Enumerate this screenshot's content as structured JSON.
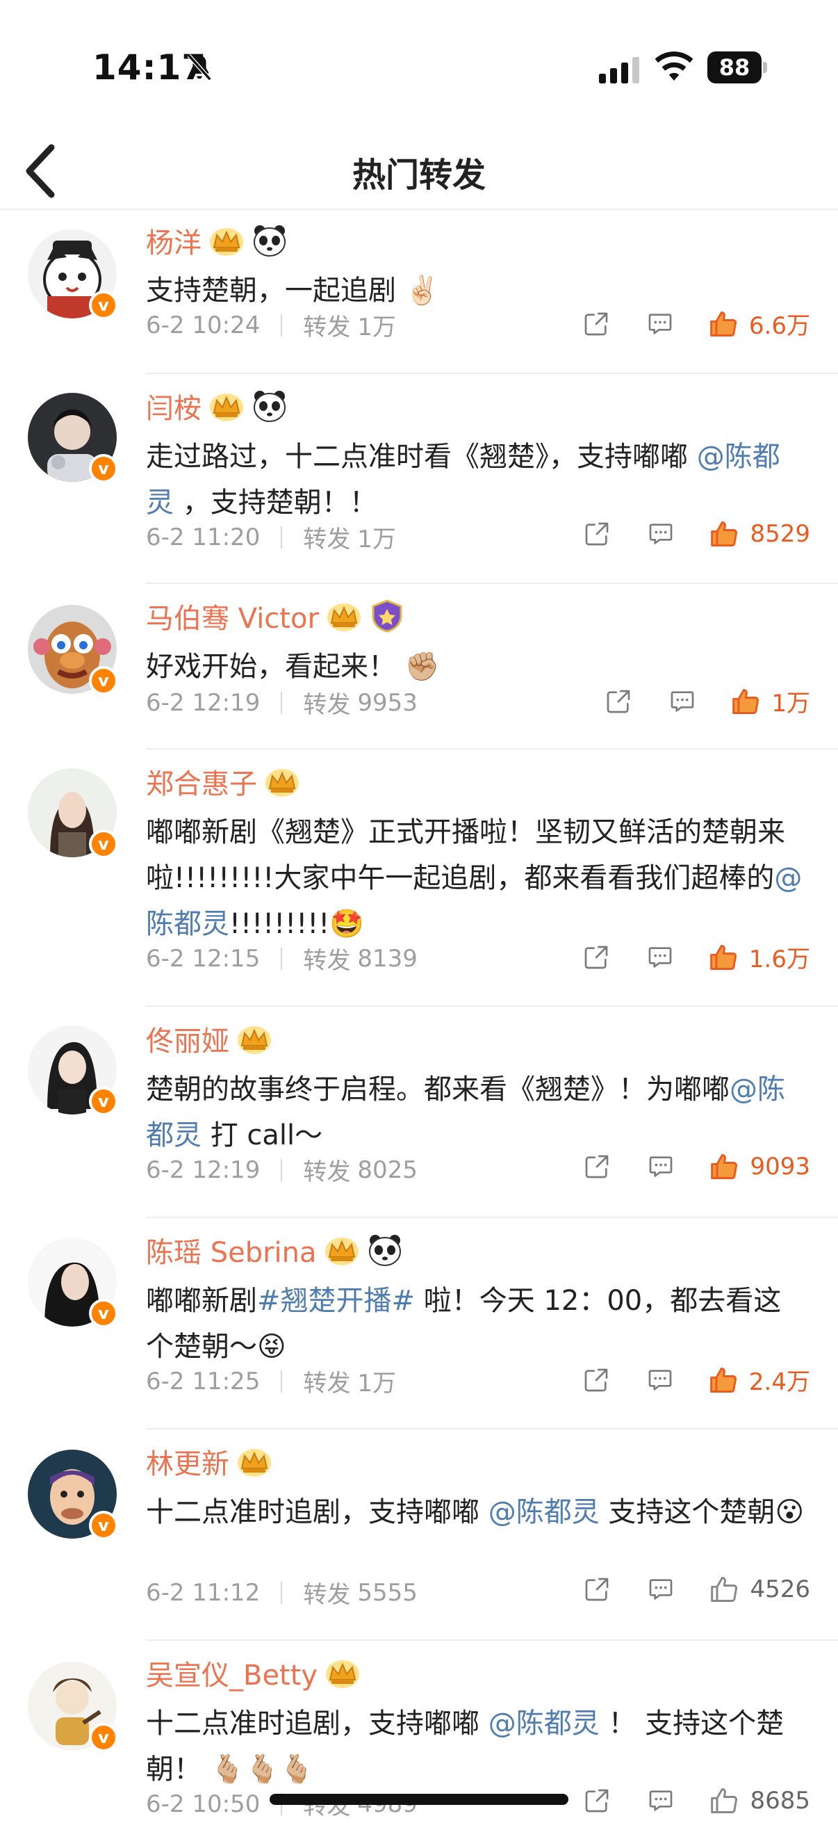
{
  "status_bar": {
    "time": "14:17",
    "battery": "88"
  },
  "nav": {
    "title": "热门转发"
  },
  "repost_label": "转发",
  "items": [
    {
      "name": "杨洋",
      "badges": [
        "crown",
        "panda"
      ],
      "text": [
        {
          "t": "支持楚朝，一起追剧 "
        },
        {
          "e": "✌🏻"
        }
      ],
      "time": "6-2 10:24",
      "repost_count": "1万",
      "likes": "6.6万",
      "liked": true
    },
    {
      "name": "闫桉",
      "badges": [
        "crown",
        "panda"
      ],
      "text": [
        {
          "t": "走过路过，十二点准时看《翘楚》，支持嘟嘟 "
        },
        {
          "m": "@陈都灵"
        },
        {
          "t": " ，支持楚朝！！"
        }
      ],
      "time": "6-2 11:20",
      "repost_count": "1万",
      "likes": "8529",
      "liked": true
    },
    {
      "name": "马伯骞 Victor",
      "badges": [
        "crown",
        "shield"
      ],
      "text": [
        {
          "t": "好戏开始，看起来！ "
        },
        {
          "e": "✊🏼"
        }
      ],
      "time": "6-2 12:19",
      "repost_count": "9953",
      "likes": "1万",
      "liked": true
    },
    {
      "name": "郑合惠子",
      "badges": [
        "crown"
      ],
      "text": [
        {
          "t": "嘟嘟新剧《翘楚》正式开播啦！坚韧又鲜活的楚朝来啦!!!!!!!!!大家中午一起追剧，都来看看我们超棒的"
        },
        {
          "m": "@陈都灵"
        },
        {
          "t": "!!!!!!!!!"
        },
        {
          "e": "🤩"
        }
      ],
      "time": "6-2 12:15",
      "repost_count": "8139",
      "likes": "1.6万",
      "liked": true
    },
    {
      "name": "佟丽娅",
      "badges": [
        "crown"
      ],
      "text": [
        {
          "t": "楚朝的故事终于启程。都来看《翘楚》！为嘟嘟"
        },
        {
          "m": "@陈都灵"
        },
        {
          "t": " 打 call～"
        }
      ],
      "time": "6-2 12:19",
      "repost_count": "8025",
      "likes": "9093",
      "liked": true
    },
    {
      "name": "陈瑶 Sebrina",
      "badges": [
        "crown",
        "panda"
      ],
      "text": [
        {
          "t": "嘟嘟新剧"
        },
        {
          "m": "#翘楚开播#"
        },
        {
          "t": " 啦！今天 12：00，都去看这个楚朝～"
        },
        {
          "e": "😝"
        }
      ],
      "time": "6-2 11:25",
      "repost_count": "1万",
      "likes": "2.4万",
      "liked": true
    },
    {
      "name": "林更新",
      "badges": [
        "crown"
      ],
      "text": [
        {
          "t": "十二点准时追剧，支持嘟嘟 "
        },
        {
          "m": "@陈都灵"
        },
        {
          "t": "  支持这个楚朝"
        },
        {
          "e": "😮"
        }
      ],
      "time": "6-2 11:12",
      "repost_count": "5555",
      "likes": "4526",
      "liked": false
    },
    {
      "name": "吴宣仪_Betty",
      "badges": [
        "crown"
      ],
      "text": [
        {
          "t": "十二点准时追剧，支持嘟嘟 "
        },
        {
          "m": "@陈都灵"
        },
        {
          "t": " ！ 支持这个楚朝！ "
        },
        {
          "e": "🫰🏼🫰🏼🫰🏼"
        }
      ],
      "time": "6-2 10:50",
      "repost_count": "4989",
      "likes": "8685",
      "liked": false
    }
  ],
  "colors": {
    "name": "#eb7350",
    "mention": "#507daf",
    "like_active": "#eb5a1e",
    "meta": "#9e9e9e",
    "verified": "#ff8200"
  }
}
